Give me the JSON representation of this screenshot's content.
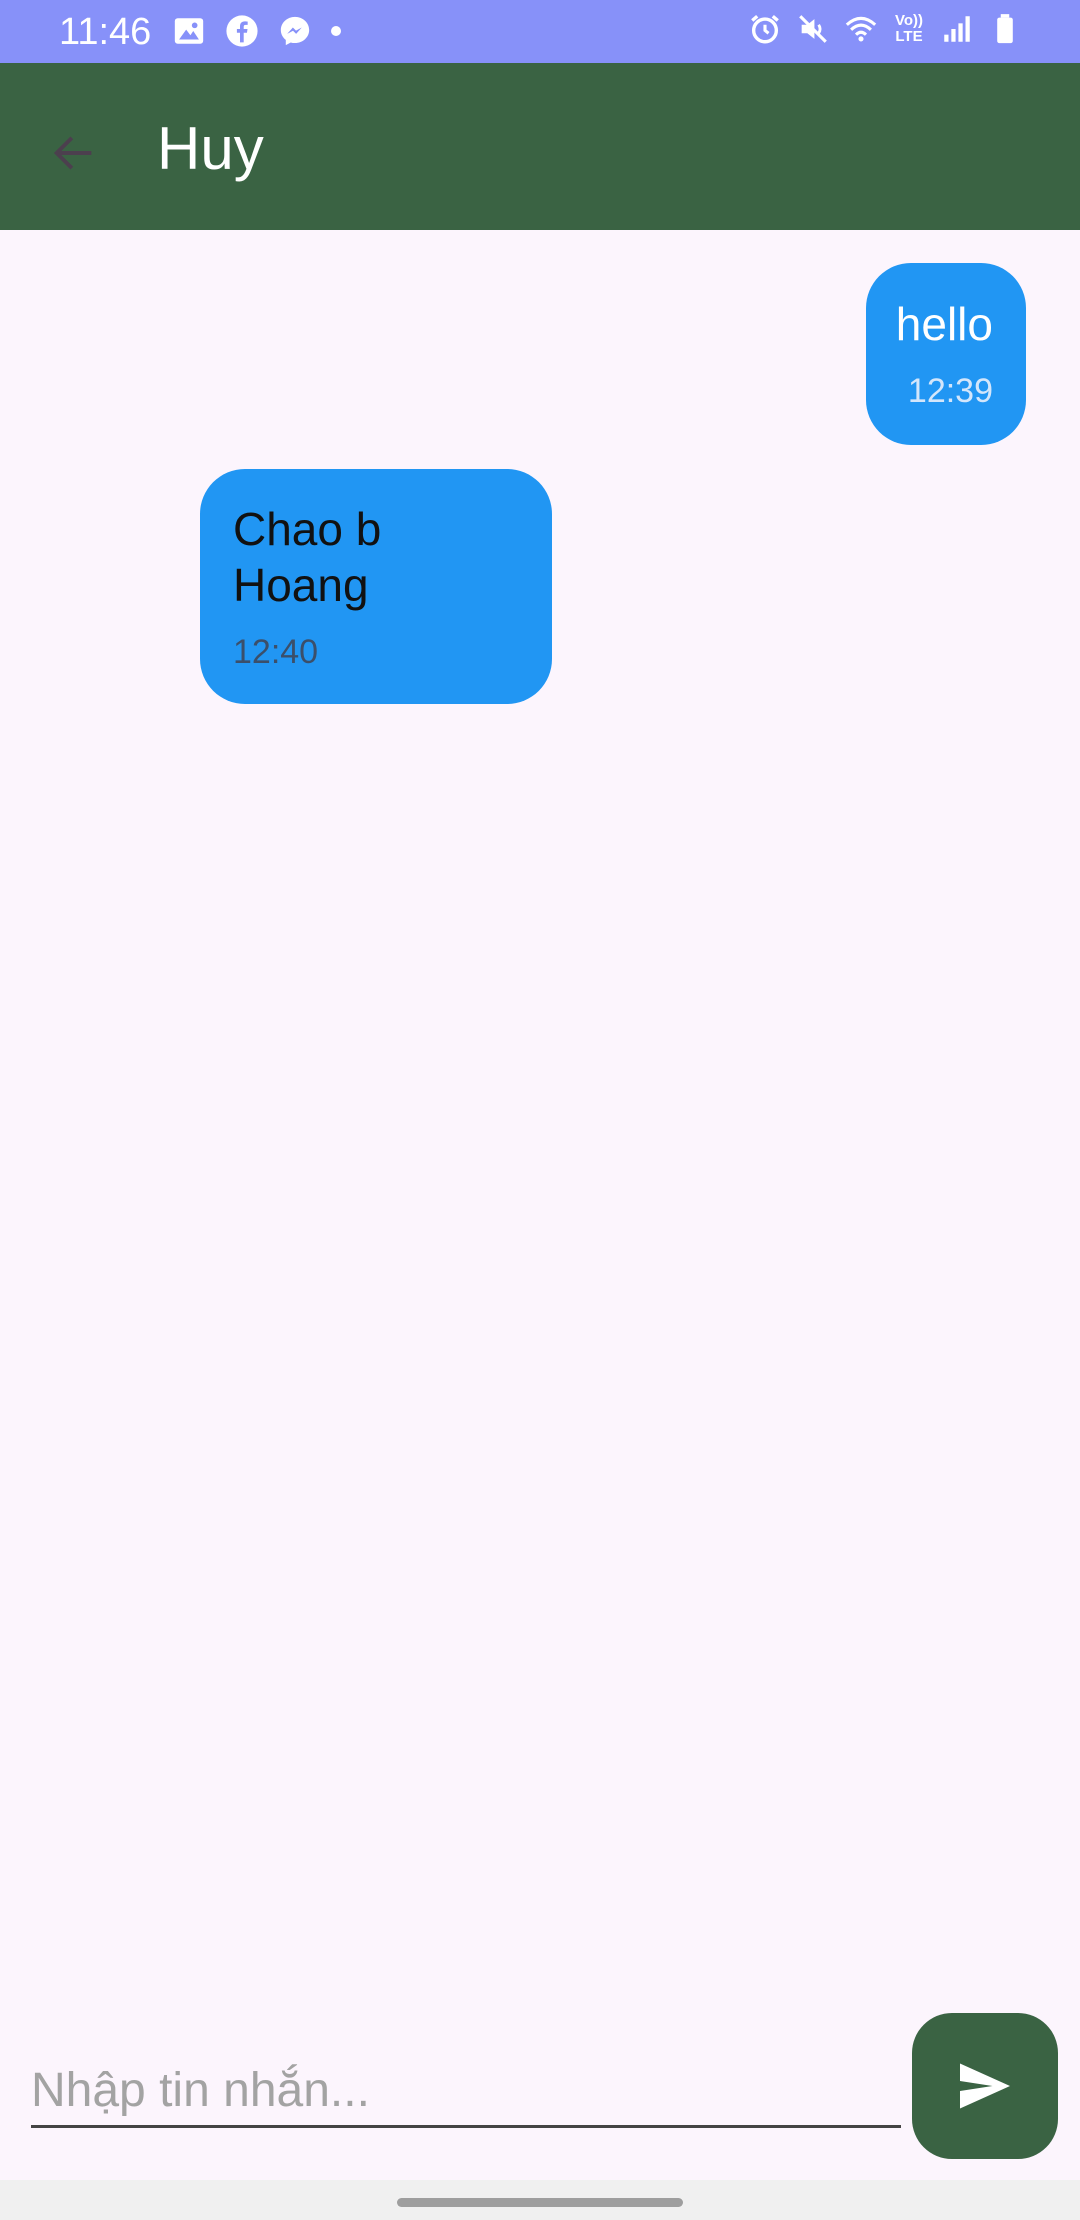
{
  "status_bar": {
    "time": "11:46",
    "left_icons": [
      "gallery-icon",
      "facebook-icon",
      "messenger-icon",
      "notification-dot"
    ],
    "right_icons": [
      "alarm-icon",
      "mute-icon",
      "wifi-icon",
      "volte-icon",
      "signal-icon",
      "battery-icon"
    ],
    "volte_label_top": "Vo))",
    "volte_label_bottom": "LTE",
    "color": "#8791f9"
  },
  "app_bar": {
    "title": "Huy",
    "color": "#3a6343",
    "back_icon": "arrow-left-icon"
  },
  "messages": [
    {
      "direction": "sent",
      "text": "hello",
      "time": "12:39"
    },
    {
      "direction": "received",
      "text": "Chao b Hoang",
      "time": "12:40"
    }
  ],
  "bubble_color": "#2196f3",
  "background_color": "#fcf5fd",
  "composer": {
    "placeholder": "Nhập tin nhắn...",
    "value": "",
    "send_icon": "send-icon"
  }
}
